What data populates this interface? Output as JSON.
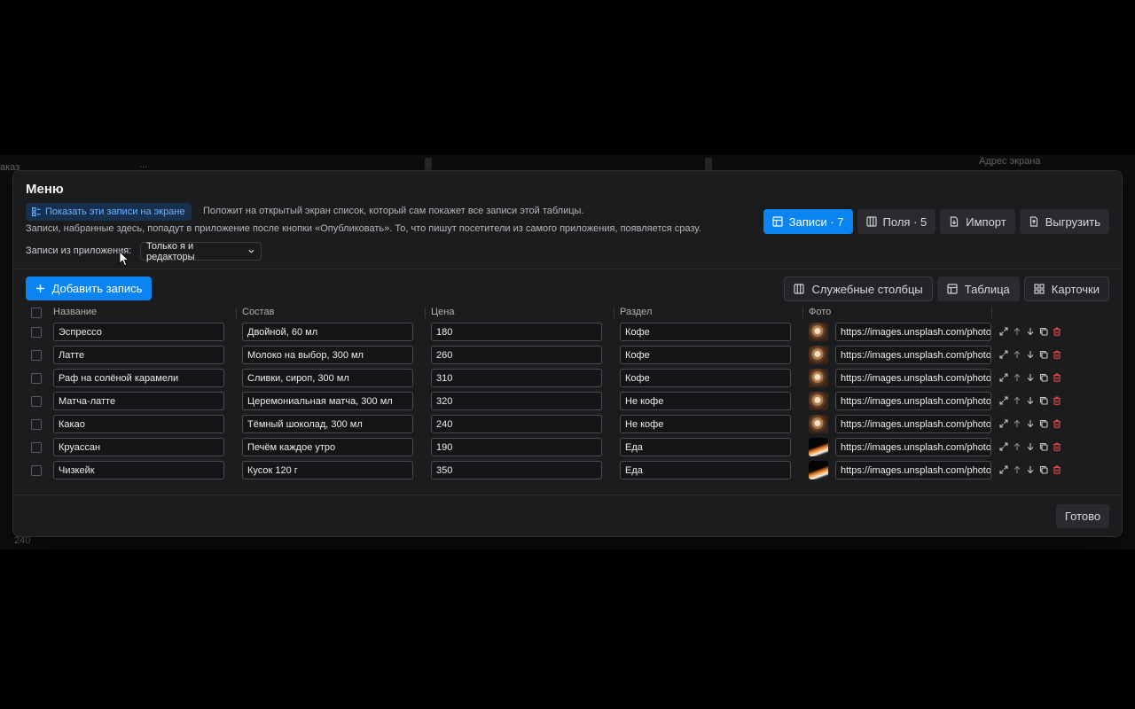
{
  "background": {
    "left_label_1": "аказ",
    "left_label_2": "...",
    "right_label": "Адрес экрана",
    "bottom_label": "240"
  },
  "modal": {
    "title": "Меню",
    "show_button": "Показать эти записи на экране",
    "show_hint": "Положит на открытый экран список, который сам покажет все записи этой таблицы.",
    "description": "Записи, набранные здесь, попадут в приложение после кнопки «Опубликовать». То, что пишут посетители из самого приложения, появляется сразу.",
    "records_label": "Записи из приложения:",
    "records_select": "Только я и редакторы",
    "tabs": [
      {
        "label": "Записи · 7",
        "icon": "table-icon"
      },
      {
        "label": "Поля · 5",
        "icon": "columns-icon"
      },
      {
        "label": "Импорт",
        "icon": "file-import-icon"
      },
      {
        "label": "Выгрузить",
        "icon": "file-export-icon"
      }
    ],
    "add_button": "Добавить запись",
    "view_buttons": [
      {
        "label": "Служебные столбцы",
        "icon": "columns-icon"
      },
      {
        "label": "Таблица",
        "icon": "table-icon"
      },
      {
        "label": "Карточки",
        "icon": "grid-icon"
      }
    ],
    "columns": [
      "Название",
      "Состав",
      "Цена",
      "Раздел",
      "Фото"
    ],
    "rows": [
      {
        "name": "Эспрессо",
        "composition": "Двойной, 60 мл",
        "price": "180",
        "section": "Кофе",
        "photo": "https://images.unsplash.com/photo",
        "thumb": "coffee"
      },
      {
        "name": "Латте",
        "composition": "Молоко на выбор, 300 мл",
        "price": "260",
        "section": "Кофе",
        "photo": "https://images.unsplash.com/photo",
        "thumb": "coffee"
      },
      {
        "name": "Раф на солёной карамели",
        "composition": "Сливки, сироп, 300 мл",
        "price": "310",
        "section": "Кофе",
        "photo": "https://images.unsplash.com/photo",
        "thumb": "coffee"
      },
      {
        "name": "Матча-латте",
        "composition": "Церемониальная матча, 300 мл",
        "price": "320",
        "section": "Не кофе",
        "photo": "https://images.unsplash.com/photo",
        "thumb": "coffee"
      },
      {
        "name": "Какао",
        "composition": "Тёмный шоколад, 300 мл",
        "price": "240",
        "section": "Не кофе",
        "photo": "https://images.unsplash.com/photo",
        "thumb": "coffee"
      },
      {
        "name": "Круассан",
        "composition": "Печём каждое утро",
        "price": "190",
        "section": "Еда",
        "photo": "https://images.unsplash.com/photo",
        "thumb": "food"
      },
      {
        "name": "Чизкейк",
        "composition": "Кусок 120 г",
        "price": "350",
        "section": "Еда",
        "photo": "https://images.unsplash.com/photo",
        "thumb": "food"
      }
    ],
    "done_button": "Готово"
  },
  "colors": {
    "accent": "#0a84f0",
    "panel": "#1b1c1e",
    "danger": "#e0484f"
  }
}
